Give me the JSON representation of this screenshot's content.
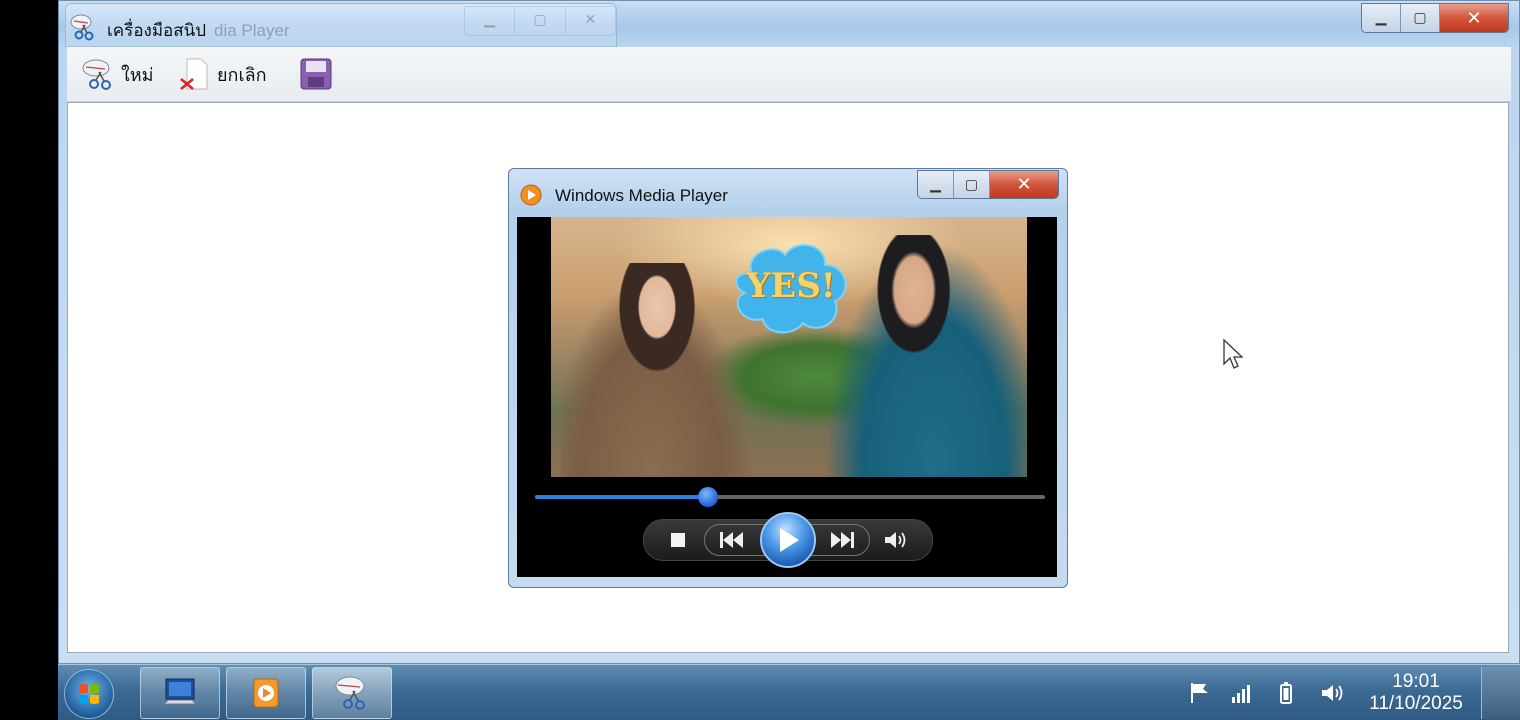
{
  "snipping_tool": {
    "title": "เครื่องมือสนิป",
    "ghost_title": "dia Player",
    "toolbar": {
      "new_label": "ใหม่",
      "cancel_label": "ยกเลิก"
    }
  },
  "media_player": {
    "title": "Windows Media Player",
    "video_overlay_text": "YES!",
    "seek_progress": 0.34
  },
  "taskbar": {
    "time": "19:01",
    "date": "11/10/2025"
  },
  "colors": {
    "accent_blue": "#2f7fe0",
    "close_red": "#c1381c",
    "taskbar": "#3b6a93"
  },
  "icons": {
    "snipping_tool": "scissors-icon",
    "media_player": "media-player-icon",
    "computer": "computer-icon",
    "flag": "flag-icon",
    "signal": "signal-icon",
    "battery": "battery-icon",
    "volume": "volume-icon"
  }
}
